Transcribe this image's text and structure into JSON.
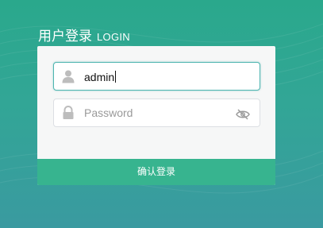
{
  "header": {
    "title": "用户登录",
    "subtitle": "LOGIN"
  },
  "form": {
    "username": {
      "value": "admin",
      "icon": "user-icon"
    },
    "password": {
      "placeholder": "Password",
      "icon": "lock-icon",
      "toggle_icon": "eye-slash-icon"
    },
    "submit_label": "确认登录"
  },
  "colors": {
    "accent": "#37b48f",
    "field_focus": "#4fb5b0",
    "background": "#32a696"
  }
}
